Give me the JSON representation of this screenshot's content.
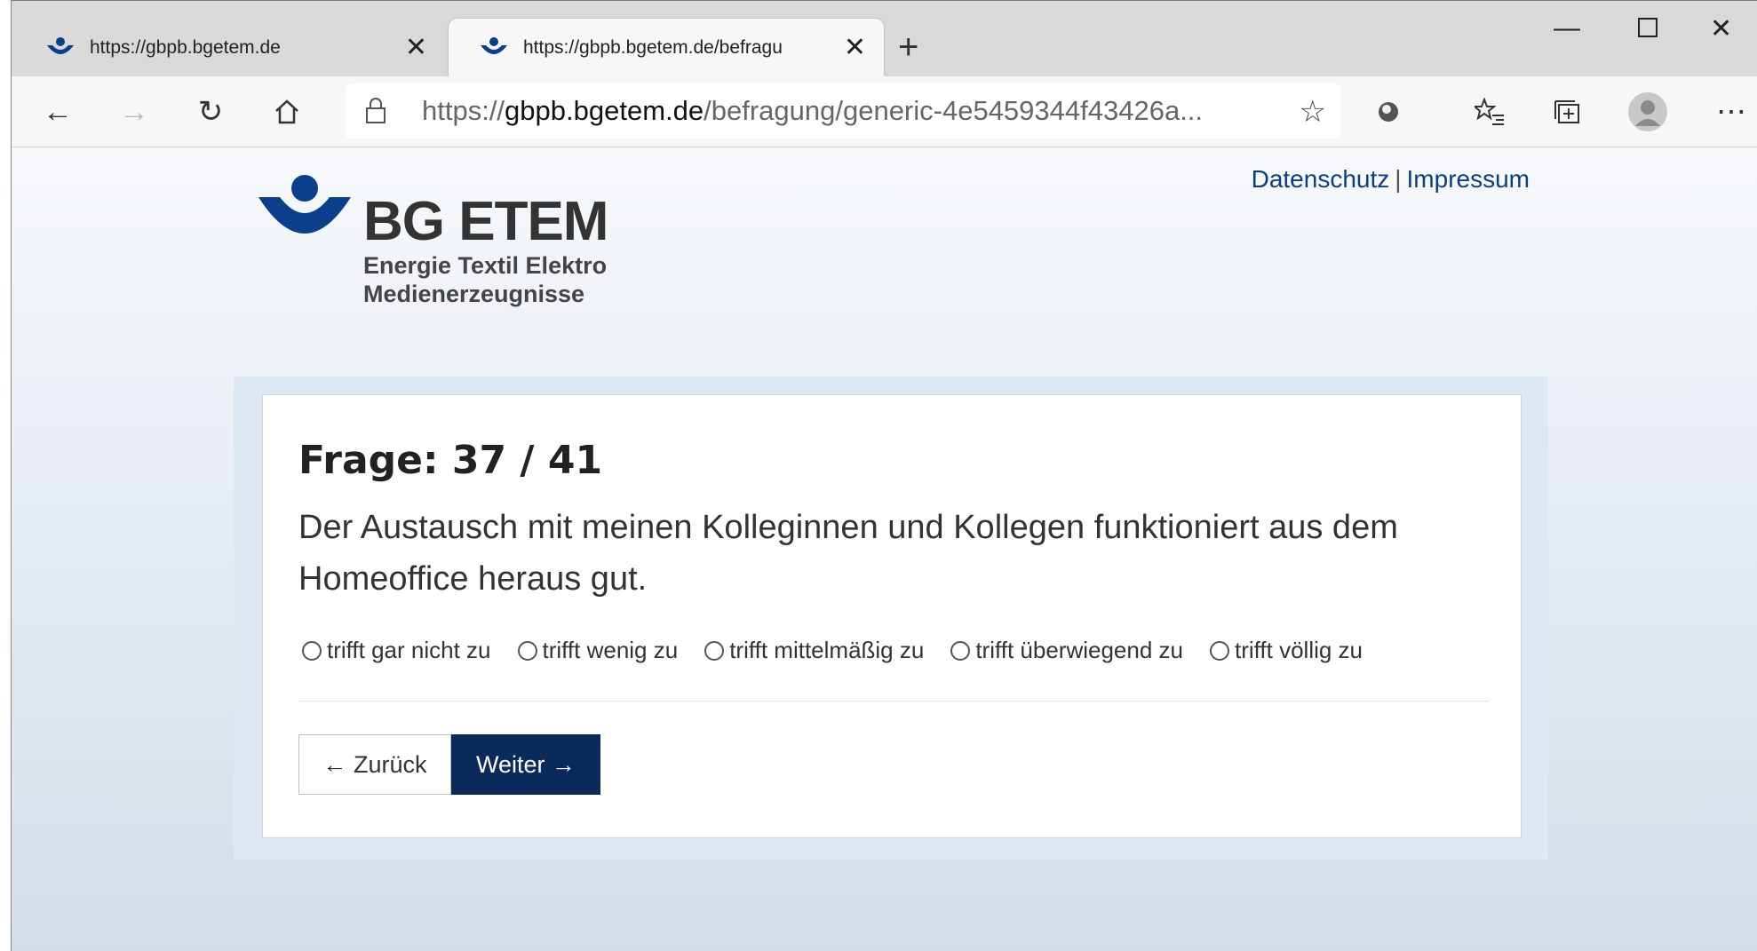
{
  "browser": {
    "tabs": [
      {
        "title": "https://gbpb.bgetem.de",
        "active": false
      },
      {
        "title": "https://gbpb.bgetem.de/befragu",
        "active": true
      }
    ],
    "address": {
      "scheme": "https://",
      "host": "gbpb.bgetem.de",
      "path": "/befragung/generic-4e5459344f43426a..."
    }
  },
  "brand": {
    "name": "BG ETEM",
    "line1": "Energie Textil Elektro",
    "line2": "Medienerzeugnisse",
    "color": "#0b3f8c"
  },
  "links": {
    "privacy": "Datenschutz",
    "separator": "|",
    "imprint": "Impressum"
  },
  "question": {
    "counter": "Frage: 37 / 41",
    "text": "Der Austausch mit meinen Kolleginnen und Kollegen funktioniert aus dem Homeoffice heraus gut.",
    "options": [
      "trifft gar nicht zu",
      "trifft wenig zu",
      "trifft mittelmäßig zu",
      "trifft überwiegend zu",
      "trifft völlig zu"
    ]
  },
  "nav": {
    "back": "← Zurück",
    "next": "Weiter →"
  }
}
